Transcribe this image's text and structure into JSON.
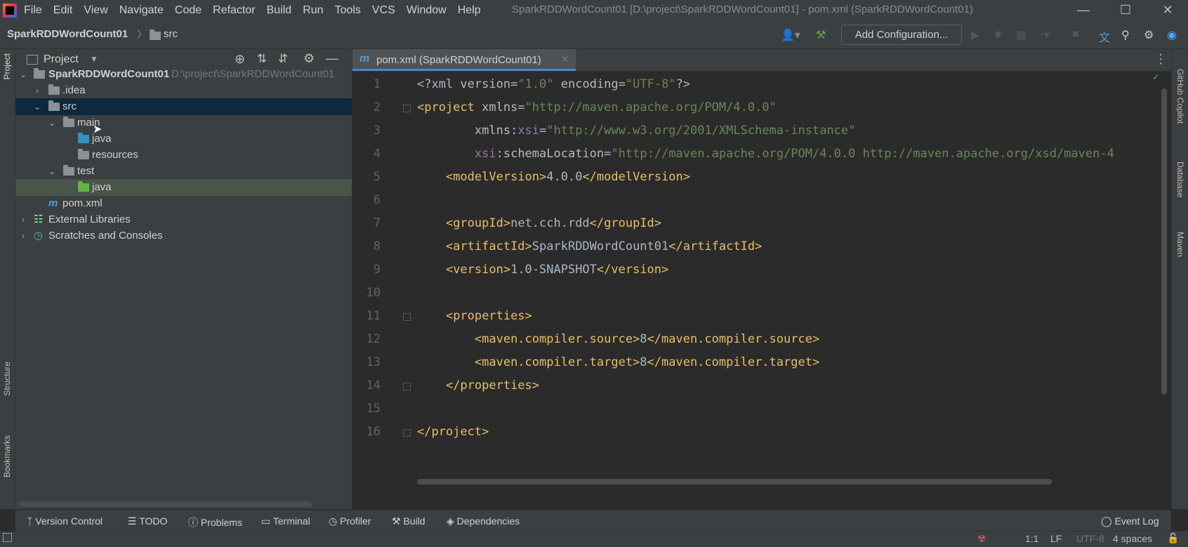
{
  "app": {
    "window_title": "SparkRDDWordCount01 [D:\\project\\SparkRDDWordCount01] - pom.xml (SparkRDDWordCount01)",
    "menu": [
      "File",
      "Edit",
      "View",
      "Navigate",
      "Code",
      "Refactor",
      "Build",
      "Run",
      "Tools",
      "VCS",
      "Window",
      "Help"
    ]
  },
  "navbar": {
    "breadcrumb_project": "SparkRDDWordCount01",
    "breadcrumb_folder": "src",
    "run_config_label": "Add Configuration..."
  },
  "project_panel": {
    "title": "Project",
    "tree": [
      {
        "label": "SparkRDDWordCount01",
        "path": "D:\\project\\SparkRDDWordCount01",
        "icon": "module-folder-icon",
        "expanded": true
      },
      {
        "label": ".idea",
        "icon": "folder-icon",
        "expanded": false
      },
      {
        "label": "src",
        "icon": "folder-icon",
        "expanded": true,
        "selected": true
      },
      {
        "label": "main",
        "icon": "folder-icon",
        "expanded": true
      },
      {
        "label": "java",
        "icon": "source-root-folder-icon"
      },
      {
        "label": "resources",
        "icon": "resources-folder-icon"
      },
      {
        "label": "test",
        "icon": "folder-icon",
        "expanded": true
      },
      {
        "label": "java",
        "icon": "test-root-folder-icon",
        "highlighted": true
      },
      {
        "label": "pom.xml",
        "icon": "maven-file-icon"
      },
      {
        "label": "External Libraries",
        "icon": "libraries-icon",
        "expanded": false
      },
      {
        "label": "Scratches and Consoles",
        "icon": "scratches-icon",
        "expanded": false
      }
    ]
  },
  "left_stripe": {
    "project": "Project",
    "structure": "Structure",
    "bookmarks": "Bookmarks"
  },
  "right_stripe": {
    "copilot": "GitHub Copilot",
    "database": "Database",
    "maven": "Maven"
  },
  "editor": {
    "tab_label": "pom.xml (SparkRDDWordCount01)",
    "line_numbers": [
      "1",
      "2",
      "3",
      "4",
      "5",
      "6",
      "7",
      "8",
      "9",
      "10",
      "11",
      "12",
      "13",
      "14",
      "15",
      "16"
    ]
  },
  "bottom_tabs": [
    "Version Control",
    "TODO",
    "Problems",
    "Terminal",
    "Profiler",
    "Build",
    "Dependencies"
  ],
  "event_log": "Event Log",
  "status": {
    "position": "1:1",
    "line_sep": "LF",
    "encoding": "UTF-8",
    "indent": "4 spaces"
  },
  "colors": {
    "accent": "#4a88c7",
    "tag": "#e8bf6a",
    "string": "#6a8759",
    "namespace": "#9876aa"
  }
}
